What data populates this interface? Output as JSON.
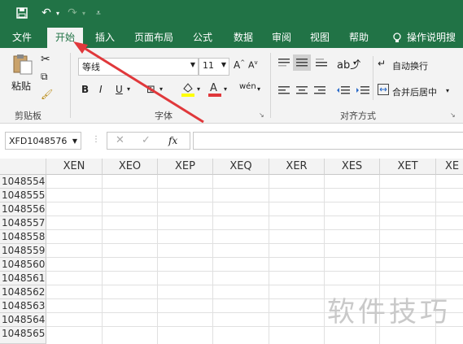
{
  "tabs": {
    "file": "文件",
    "home": "开始",
    "insert": "插入",
    "page_layout": "页面布局",
    "formulas": "公式",
    "data": "数据",
    "review": "审阅",
    "view": "视图",
    "help": "帮助",
    "tell_me": "操作说明搜"
  },
  "ribbon": {
    "clipboard": {
      "paste": "粘贴",
      "label": "剪贴板"
    },
    "font": {
      "name": "等线",
      "size": "11",
      "label": "字体",
      "bold": "B",
      "italic": "I",
      "underline": "U"
    },
    "alignment": {
      "wrap_text": "自动换行",
      "merge_center": "合并后居中",
      "label": "对齐方式"
    }
  },
  "formula_bar": {
    "name_box": "XFD1048576",
    "fx": "fx"
  },
  "grid": {
    "columns": [
      "XEN",
      "XEO",
      "XEP",
      "XEQ",
      "XER",
      "XES",
      "XET",
      "XE"
    ],
    "rows": [
      "1048554",
      "1048555",
      "1048556",
      "1048557",
      "1048558",
      "1048559",
      "1048560",
      "1048561",
      "1048562",
      "1048563",
      "1048564",
      "1048565"
    ]
  },
  "watermark": "软件技巧",
  "colors": {
    "excel_green": "#217346",
    "annotation_red": "#e0383b"
  }
}
